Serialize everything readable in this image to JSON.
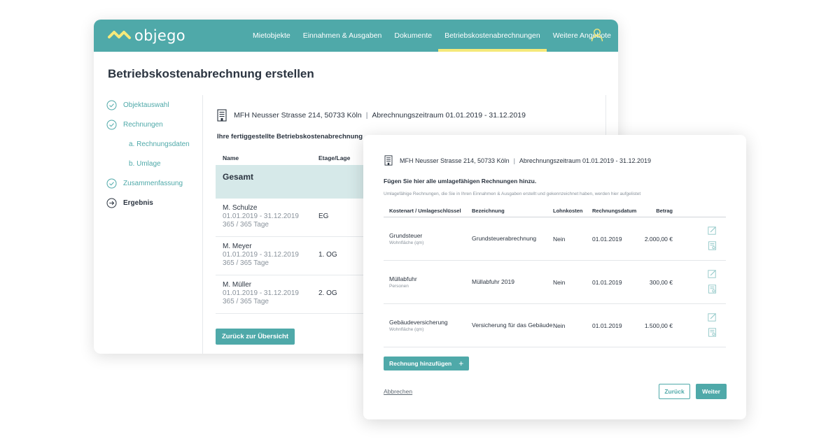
{
  "app": {
    "logo_text": "objego",
    "accent_color": "#4fa9a9",
    "highlight_color": "#f5e97a"
  },
  "nav": {
    "items": [
      {
        "label": "Mietobjekte",
        "active": false
      },
      {
        "label": "Einnahmen & Ausgaben",
        "active": false
      },
      {
        "label": "Dokumente",
        "active": false
      },
      {
        "label": "Betriebskostenabrechnungen",
        "active": true
      },
      {
        "label": "Weitere Angebote",
        "active": false
      }
    ],
    "user_icon": "user-icon"
  },
  "page": {
    "title": "Betriebskostenabrechnung erstellen"
  },
  "steps": [
    {
      "label": "Objektauswahl",
      "state": "done"
    },
    {
      "label": "Rechnungen",
      "state": "done"
    },
    {
      "label": "a. Rechnungsdaten",
      "state": "sub"
    },
    {
      "label": "b. Umlage",
      "state": "sub"
    },
    {
      "label": "Zusammenfassung",
      "state": "done"
    },
    {
      "label": "Ergebnis",
      "state": "current"
    }
  ],
  "object": {
    "name": "MFH Neusser Strasse 214, 50733 Köln",
    "separator": "|",
    "period": "Abrechnungszeitraum 01.01.2019 - 31.12.2019"
  },
  "result": {
    "title": "Ihre fertiggestellte Betriebskostenabrechnung",
    "headers": {
      "name": "Name",
      "floor": "Etage/Lage"
    },
    "total_label": "Gesamt",
    "rows": [
      {
        "name": "M. Schulze",
        "period": "01.01.2019 - 31.12.2019",
        "days": "365 / 365 Tage",
        "floor": "EG"
      },
      {
        "name": "M. Meyer",
        "period": "01.01.2019 - 31.12.2019",
        "days": "365 / 365 Tage",
        "floor": "1. OG"
      },
      {
        "name": "M. Müller",
        "period": "01.01.2019 - 31.12.2019",
        "days": "365 / 365 Tage",
        "floor": "2. OG"
      }
    ],
    "back_button": "Zurück zur Übersicht"
  },
  "invoices": {
    "title": "Fügen Sie hier alle umlagefähigen Rechnungen hinzu.",
    "subtitle": "Umlagefähige Rechnungen, die Sie in Ihren Einnahmen & Ausgaben erstellt und gekennzeichnet haben, werden hier aufgelistet",
    "headers": {
      "kind": "Kostenart / Umlageschlüssel",
      "desc": "Bezeichnung",
      "wage": "Lohnkosten",
      "date": "Rechnungsdatum",
      "amount": "Betrag"
    },
    "rows": [
      {
        "kind": "Grundsteuer",
        "key": "Wohnfläche (qm)",
        "desc": "Grundsteuerabrechnung",
        "wage": "Nein",
        "date": "01.01.2019",
        "amount": "2.000,00 €"
      },
      {
        "kind": "Müllabfuhr",
        "key": "Personen",
        "desc": "Müllabfuhr 2019",
        "wage": "Nein",
        "date": "01.01.2019",
        "amount": "300,00 €"
      },
      {
        "kind": "Gebäudeversicherung",
        "key": "Wohnfläche (qm)",
        "desc": "Versicherung für das Gebäude",
        "wage": "Nein",
        "date": "01.01.2019",
        "amount": "1.500,00 €"
      }
    ],
    "add_button": "Rechnung hinzufügen",
    "add_icon": "+",
    "cancel_link": "Abbrechen",
    "back_button": "Zurück",
    "next_button": "Weiter"
  }
}
